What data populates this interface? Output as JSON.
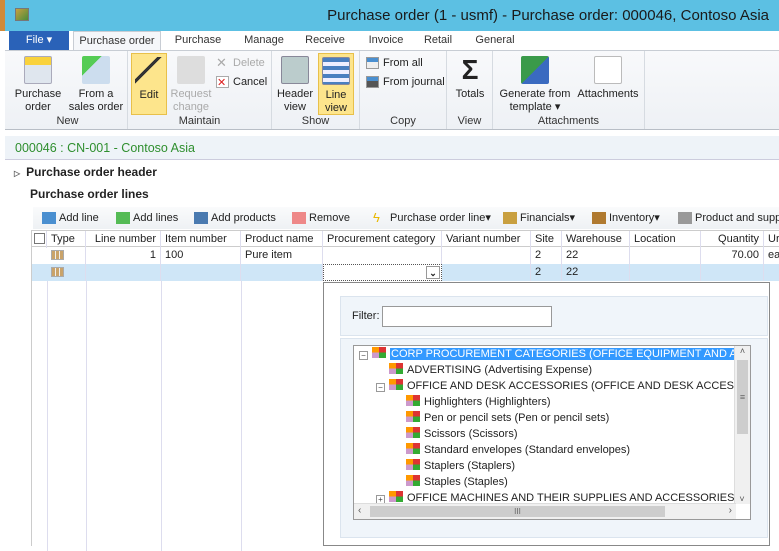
{
  "window": {
    "title": "Purchase order (1 - usmf) - Purchase order: 000046, Contoso Asia"
  },
  "tabs": [
    {
      "label": "File"
    },
    {
      "label": "Purchase order"
    },
    {
      "label": "Purchase"
    },
    {
      "label": "Manage"
    },
    {
      "label": "Receive"
    },
    {
      "label": "Invoice"
    },
    {
      "label": "Retail"
    },
    {
      "label": "General"
    }
  ],
  "ribbon": {
    "new": {
      "label": "New",
      "purchase_order": "Purchase order",
      "from_sales": "From a sales order"
    },
    "maintain": {
      "label": "Maintain",
      "edit": "Edit",
      "request_change": "Request change",
      "delete": "Delete",
      "cancel": "Cancel"
    },
    "show": {
      "label": "Show",
      "header_view": "Header view",
      "line_view": "Line view"
    },
    "copy": {
      "label": "Copy",
      "from_all": "From all",
      "from_journal": "From journal"
    },
    "view": {
      "label": "View",
      "totals": "Totals"
    },
    "attachments": {
      "label": "Attachments",
      "generate": "Generate from template",
      "attachments": "Attachments"
    }
  },
  "breadcrumb": "000046 : CN-001 - Contoso Asia",
  "sections": {
    "header": "Purchase order header",
    "lines": "Purchase order lines"
  },
  "toolbar": [
    "Add line",
    "Add lines",
    "Add products",
    "Remove",
    "Purchase order line",
    "Financials",
    "Inventory",
    "Product and suppl"
  ],
  "grid": {
    "columns": [
      "Type",
      "Line number",
      "Item number",
      "Product name",
      "Procurement category",
      "Variant number",
      "Site",
      "Warehouse",
      "Location",
      "Quantity",
      "Ur"
    ],
    "rows": [
      [
        "",
        "1",
        "100",
        "Pure item",
        "",
        "",
        "2",
        "22",
        "",
        "70.00",
        "ea"
      ],
      [
        "",
        "",
        "",
        "",
        "",
        "",
        "2",
        "22",
        "",
        "",
        ""
      ]
    ]
  },
  "popup": {
    "filter_label": "Filter:",
    "filter_value": "",
    "tree": [
      {
        "label": "CORP PROCUREMENT CATEGORIES (OFFICE EQUIPMENT AND ACCESSOR",
        "level": 0,
        "expanded": true,
        "selected": true
      },
      {
        "label": "ADVERTISING (Advertising Expense)",
        "level": 1
      },
      {
        "label": "OFFICE AND DESK ACCESSORIES (OFFICE AND DESK ACCESSORIES)",
        "level": 1,
        "expanded": true
      },
      {
        "label": "Highlighters (Highlighters)",
        "level": 2
      },
      {
        "label": "Pen or pencil sets (Pen or pencil sets)",
        "level": 2
      },
      {
        "label": "Scissors (Scissors)",
        "level": 2
      },
      {
        "label": "Standard envelopes (Standard envelopes)",
        "level": 2
      },
      {
        "label": "Staplers (Staplers)",
        "level": 2
      },
      {
        "label": "Staples (Staples)",
        "level": 2
      },
      {
        "label": "OFFICE MACHINES AND THEIR SUPPLIES AND ACCESSORIES (New cat",
        "level": 1,
        "expanded": false
      }
    ]
  },
  "colors": {
    "titlebar": "#5cc0e3",
    "file_tab": "#2a62b8",
    "selected_button": "#fde58c",
    "breadcrumb_text": "#2f8f2f",
    "selection": "#3399ff"
  }
}
